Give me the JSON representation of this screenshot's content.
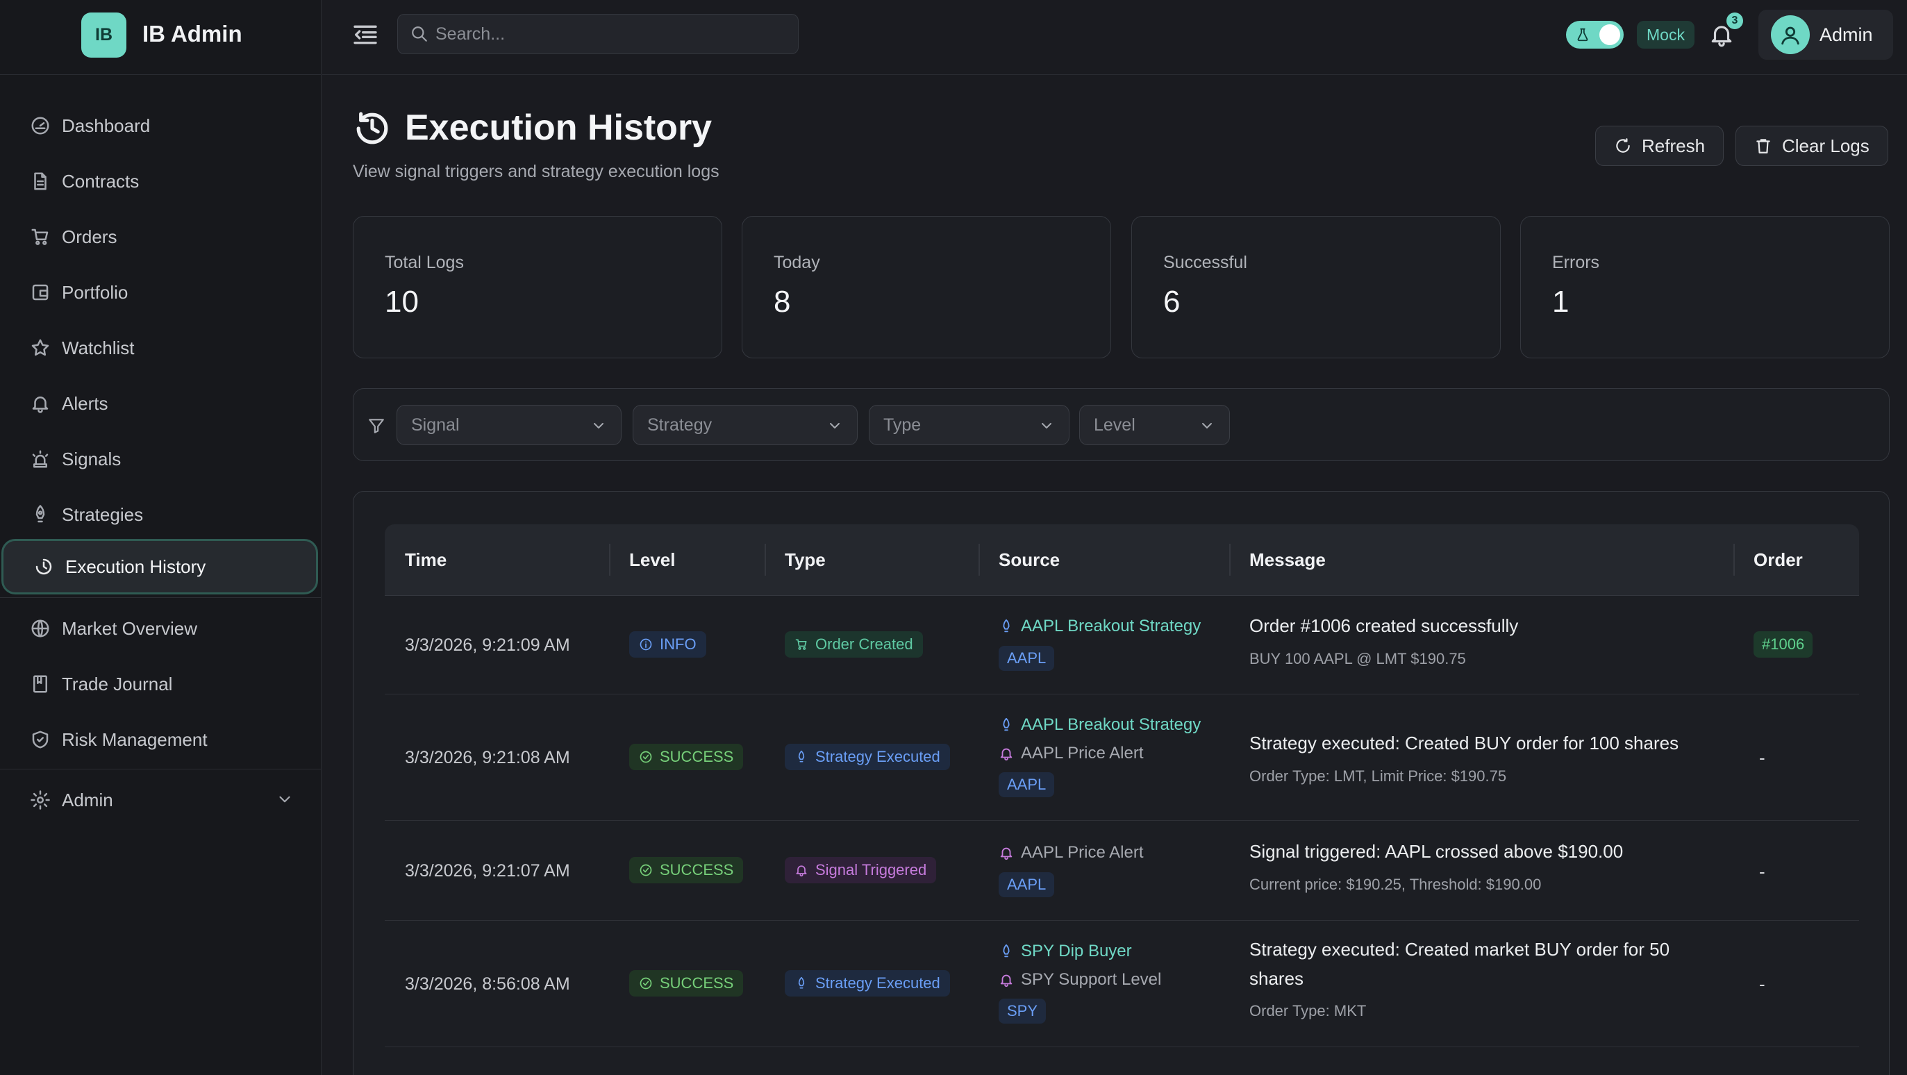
{
  "app": {
    "logo": "IB",
    "name": "IB Admin"
  },
  "sidebar": {
    "items": [
      {
        "label": "Dashboard",
        "icon": "gauge-icon"
      },
      {
        "label": "Contracts",
        "icon": "file-icon"
      },
      {
        "label": "Orders",
        "icon": "cart-icon"
      },
      {
        "label": "Portfolio",
        "icon": "wallet-icon"
      },
      {
        "label": "Watchlist",
        "icon": "star-icon"
      },
      {
        "label": "Alerts",
        "icon": "bell-icon"
      },
      {
        "label": "Signals",
        "icon": "alarm-icon"
      },
      {
        "label": "Strategies",
        "icon": "rocket-icon"
      },
      {
        "label": "Execution History",
        "icon": "history-icon",
        "active": true
      }
    ],
    "items2": [
      {
        "label": "Market Overview",
        "icon": "globe-icon"
      },
      {
        "label": "Trade Journal",
        "icon": "book-icon"
      },
      {
        "label": "Risk Management",
        "icon": "shield-icon"
      }
    ],
    "admin": {
      "label": "Admin",
      "icon": "gear-icon"
    }
  },
  "header": {
    "search_placeholder": "Search...",
    "mode_label": "Mock",
    "notification_count": "3",
    "user_name": "Admin"
  },
  "page": {
    "title": "Execution History",
    "subtitle": "View signal triggers and strategy execution logs",
    "refresh_label": "Refresh",
    "clear_label": "Clear Logs"
  },
  "stats": [
    {
      "label": "Total Logs",
      "value": "10"
    },
    {
      "label": "Today",
      "value": "8"
    },
    {
      "label": "Successful",
      "value": "6"
    },
    {
      "label": "Errors",
      "value": "1"
    }
  ],
  "filters": [
    {
      "placeholder": "Signal"
    },
    {
      "placeholder": "Strategy"
    },
    {
      "placeholder": "Type"
    },
    {
      "placeholder": "Level"
    }
  ],
  "table": {
    "columns": [
      "Time",
      "Level",
      "Type",
      "Source",
      "Message",
      "Order"
    ],
    "rows": [
      {
        "time": "3/3/2026, 9:21:09 AM",
        "level": "INFO",
        "type": "Order Created",
        "strategy": "AAPL Breakout Strategy",
        "signal": "",
        "symbol": "AAPL",
        "message": "Order #1006 created successfully",
        "detail": "BUY 100 AAPL @ LMT $190.75",
        "order": "#1006"
      },
      {
        "time": "3/3/2026, 9:21:08 AM",
        "level": "SUCCESS",
        "type": "Strategy Executed",
        "strategy": "AAPL Breakout Strategy",
        "signal": "AAPL Price Alert",
        "symbol": "AAPL",
        "message": "Strategy executed: Created BUY order for 100 shares",
        "detail": "Order Type: LMT, Limit Price: $190.75",
        "order": "-"
      },
      {
        "time": "3/3/2026, 9:21:07 AM",
        "level": "SUCCESS",
        "type": "Signal Triggered",
        "strategy": "",
        "signal": "AAPL Price Alert",
        "symbol": "AAPL",
        "message": "Signal triggered: AAPL crossed above $190.00",
        "detail": "Current price: $190.25, Threshold: $190.00",
        "order": "-"
      },
      {
        "time": "3/3/2026, 8:56:08 AM",
        "level": "SUCCESS",
        "type": "Strategy Executed",
        "strategy": "SPY Dip Buyer",
        "signal": "SPY Support Level",
        "symbol": "SPY",
        "message": "Strategy executed: Created market BUY order for 50",
        "message2": "shares",
        "detail": "Order Type: MKT",
        "order": "-"
      }
    ]
  }
}
